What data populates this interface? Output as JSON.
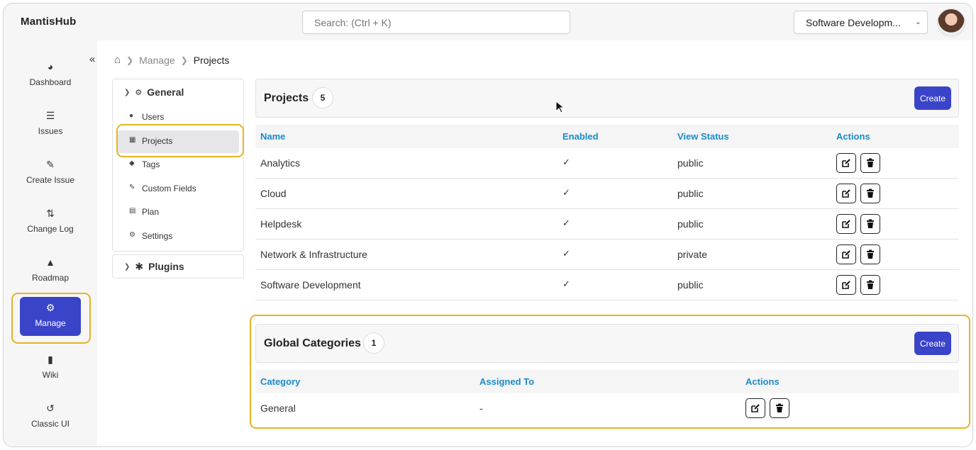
{
  "app": {
    "name": "MantisHub"
  },
  "search": {
    "placeholder": "Search: (Ctrl + K)"
  },
  "project_selector": {
    "value": "Software Developm..."
  },
  "sidebar": {
    "items": [
      {
        "label": "Dashboard",
        "icon": "dashboard-icon"
      },
      {
        "label": "Issues",
        "icon": "list-icon"
      },
      {
        "label": "Create Issue",
        "icon": "edit-icon"
      },
      {
        "label": "Change Log",
        "icon": "refresh-icon"
      },
      {
        "label": "Roadmap",
        "icon": "road-icon"
      },
      {
        "label": "Manage",
        "icon": "cogs-icon",
        "active": true
      },
      {
        "label": "Wiki",
        "icon": "file-icon"
      },
      {
        "label": "Classic UI",
        "icon": "history-icon"
      }
    ]
  },
  "breadcrumb": {
    "items": [
      "Manage",
      "Projects"
    ]
  },
  "settings_panel": {
    "general_label": "General",
    "items": [
      {
        "label": "Users",
        "icon": "users-icon"
      },
      {
        "label": "Projects",
        "icon": "table-icon",
        "active": true
      },
      {
        "label": "Tags",
        "icon": "tags-icon"
      },
      {
        "label": "Custom Fields",
        "icon": "pencil-icon"
      },
      {
        "label": "Plan",
        "icon": "bank-icon"
      },
      {
        "label": "Settings",
        "icon": "gear-icon"
      }
    ],
    "plugins_label": "Plugins"
  },
  "projects": {
    "title": "Projects",
    "count": "5",
    "create_label": "Create",
    "columns": [
      "Name",
      "Enabled",
      "View Status",
      "Actions"
    ],
    "rows": [
      {
        "name": "Analytics",
        "enabled": true,
        "view_status": "public"
      },
      {
        "name": "Cloud",
        "enabled": true,
        "view_status": "public"
      },
      {
        "name": "Helpdesk",
        "enabled": true,
        "view_status": "public"
      },
      {
        "name": "Network & Infrastructure",
        "enabled": true,
        "view_status": "private"
      },
      {
        "name": "Software Development",
        "enabled": true,
        "view_status": "public"
      }
    ]
  },
  "global_categories": {
    "title": "Global Categories",
    "count": "1",
    "create_label": "Create",
    "columns": [
      "Category",
      "Assigned To",
      "Actions"
    ],
    "rows": [
      {
        "category": "General",
        "assigned_to": "-"
      }
    ]
  },
  "colors": {
    "accent": "#3a44c9",
    "link": "#1a8bc9",
    "highlight": "#e6b325"
  }
}
